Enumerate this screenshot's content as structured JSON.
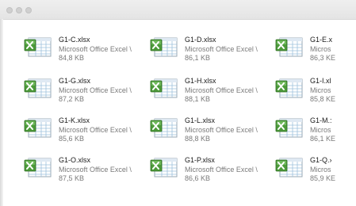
{
  "window": {
    "title": ""
  },
  "icons": {
    "file_icon": "excel-spreadsheet-icon",
    "accent_green": "#4c9a3a",
    "sheet_grid": "#8fb8d8"
  },
  "files": [
    {
      "name": "G1-C.xlsx",
      "type": "Microsoft Office Excel \\",
      "size": "84,8 KB"
    },
    {
      "name": "G1-D.xlsx",
      "type": "Microsoft Office Excel \\",
      "size": "86,1 KB"
    },
    {
      "name": "G1-E.x",
      "type": "Micros",
      "size": "86,3 KE"
    },
    {
      "name": "G1-G.xlsx",
      "type": "Microsoft Office Excel \\",
      "size": "87,2 KB"
    },
    {
      "name": "G1-H.xlsx",
      "type": "Microsoft Office Excel \\",
      "size": "88,1 KB"
    },
    {
      "name": "G1-I.xl",
      "type": "Micros",
      "size": "85,8 KE"
    },
    {
      "name": "G1-K.xlsx",
      "type": "Microsoft Office Excel \\",
      "size": "85,6 KB"
    },
    {
      "name": "G1-L.xlsx",
      "type": "Microsoft Office Excel \\",
      "size": "88,8 KB"
    },
    {
      "name": "G1-M.:",
      "type": "Micros",
      "size": "86,1 KE"
    },
    {
      "name": "G1-O.xlsx",
      "type": "Microsoft Office Excel \\",
      "size": "87,5 KB"
    },
    {
      "name": "G1-P.xlsx",
      "type": "Microsoft Office Excel \\",
      "size": "86,6 KB"
    },
    {
      "name": "G1-Q.›",
      "type": "Micros",
      "size": "85,9 KE"
    }
  ]
}
